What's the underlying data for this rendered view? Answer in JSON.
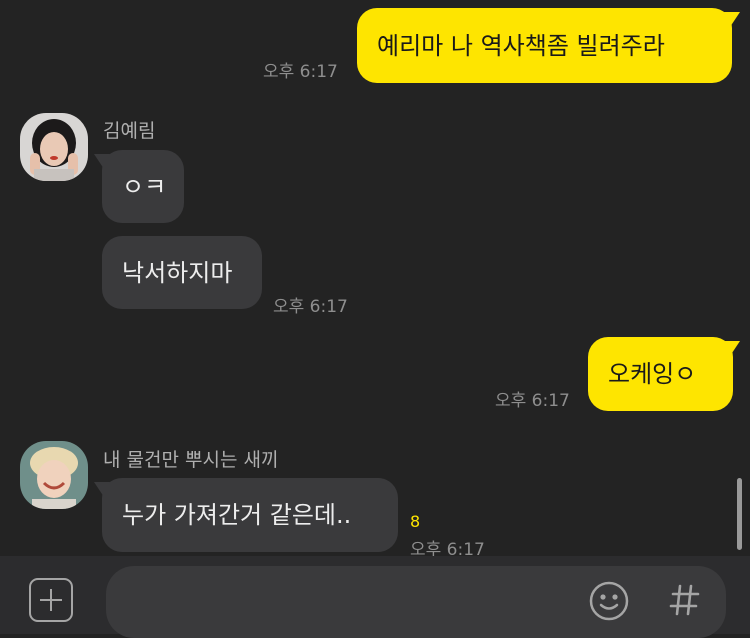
{
  "messages": [
    {
      "sender": "me",
      "text": "예리마 나 역사책좀 빌려주라",
      "time": "오후 6:17"
    },
    {
      "sender": "김예림",
      "texts": [
        "ㅇㅋ",
        "낙서하지마"
      ],
      "time": "오후 6:17"
    },
    {
      "sender": "me",
      "text": "오케잉ㅇ",
      "time": "오후 6:17"
    },
    {
      "sender": "내 물건만 뿌시는 새끼",
      "text": "누가 가져간거 같은데..",
      "unread": "8",
      "time": "오후 6:17"
    }
  ],
  "input": {
    "placeholder": ""
  },
  "icons": {
    "attach": "plus-icon",
    "emoji": "smile-icon",
    "hashtag": "hash-icon"
  },
  "colors": {
    "my_bubble": "#FEE500",
    "their_bubble": "#3A3A3C",
    "background": "#232323"
  }
}
